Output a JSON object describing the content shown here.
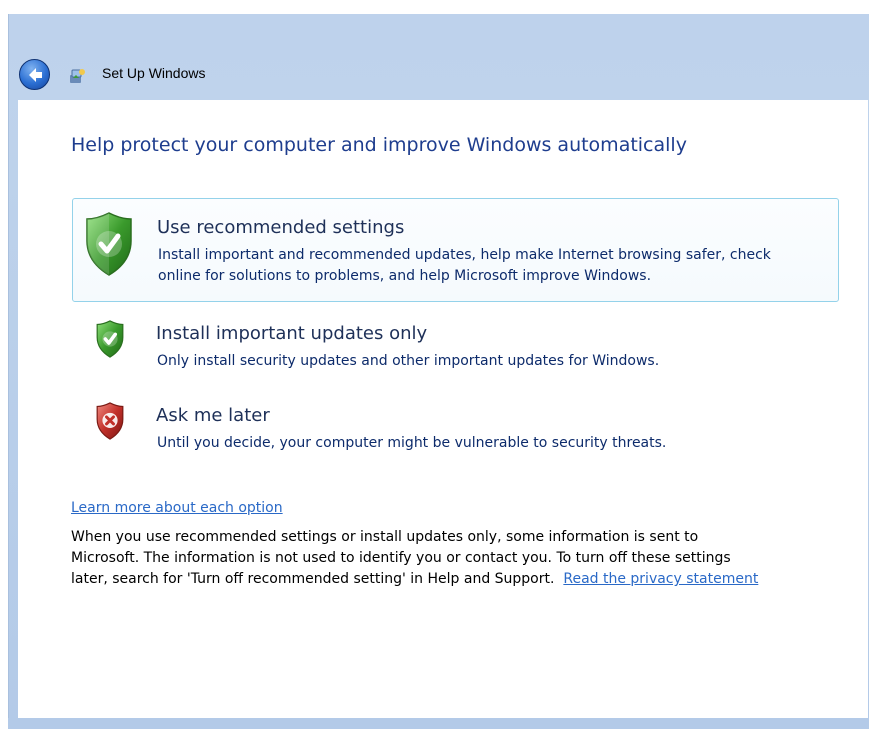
{
  "window": {
    "title": "Set Up Windows"
  },
  "page": {
    "heading": "Help protect your computer and improve Windows automatically"
  },
  "options": [
    {
      "title": "Use recommended settings",
      "desc_line1": "Install important and recommended updates, help make Internet browsing safer, check",
      "desc_line2": "online for solutions to problems, and help Microsoft improve Windows.",
      "icon": "shield-check-icon",
      "selected": true
    },
    {
      "title": "Install important updates only",
      "desc_line1": "Only install security updates and other important updates for Windows.",
      "icon": "shield-check-icon",
      "selected": false
    },
    {
      "title": "Ask me later",
      "desc_line1": "Until you decide, your computer might be vulnerable to security threats.",
      "icon": "shield-x-icon",
      "selected": false
    }
  ],
  "info": {
    "learn_more": "Learn more about each option",
    "line1": "When you use recommended settings or install updates only, some information is sent to",
    "line2": "Microsoft.  The information is not used to identify you or contact you.  To turn off these settings",
    "line3": "later, search for 'Turn off recommended setting' in Help and Support.",
    "privacy_link": "Read the privacy statement"
  },
  "colors": {
    "heading": "#1e3d8e",
    "link": "#2a69c7",
    "frame": "#b3cae8",
    "selected_border": "#94d2ea",
    "shield_green": "#3a9a2c",
    "shield_red": "#c2302a"
  }
}
